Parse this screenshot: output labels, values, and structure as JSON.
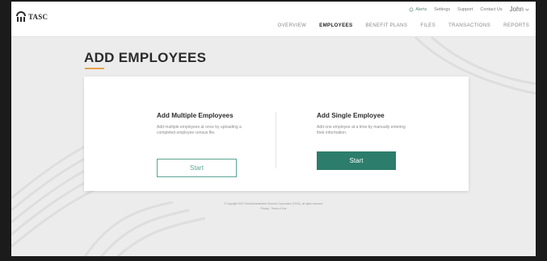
{
  "app": {
    "logo_text": "TASC"
  },
  "util_nav": {
    "alerts": "Alerts",
    "settings": "Settings",
    "support": "Support",
    "contact": "Contact Us",
    "user": "John"
  },
  "main_nav": {
    "items": [
      "OVERVIEW",
      "EMPLOYEES",
      "BENEFIT PLANS",
      "FILES",
      "TRANSACTIONS",
      "REPORTS"
    ],
    "active": "EMPLOYEES"
  },
  "page": {
    "title": "ADD EMPLOYEES"
  },
  "multiple": {
    "heading": "Add Multiple Employees",
    "description": "Add multiple employees at once by uploading a completed employee census file.",
    "button": "Start"
  },
  "single": {
    "heading": "Add Single Employee",
    "description": "Add one employee at a time by manually entering their information.",
    "button": "Start"
  },
  "footer": {
    "copyright": "© Copyright 2021 Total Administrative Services Corporation (TASC), all rights reserved.",
    "links": "Privacy · Terms of Use"
  },
  "colors": {
    "accent": "#2c7d6b",
    "accent_light": "#5ba592",
    "title_underline": "#e3a34a"
  }
}
